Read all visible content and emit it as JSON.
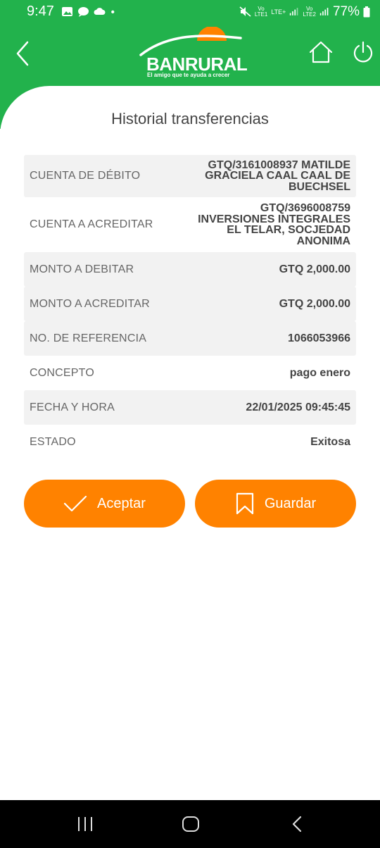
{
  "status_bar": {
    "time": "9:47",
    "sim1_line1": "Vo",
    "sim1_line2": "LTE1",
    "network_label": "LTE+",
    "sim2_line1": "Vo",
    "sim2_line2": "LTE2",
    "battery_percent": "77%",
    "icons": [
      "gallery-icon",
      "chat-icon",
      "cloud-icon",
      "dot-icon",
      "mute-icon",
      "signal-icon",
      "battery-icon"
    ]
  },
  "header": {
    "brand": "BANRURAL",
    "tagline": "El amigo que te ayuda a crecer",
    "colors": {
      "header_green": "#22b24c",
      "logo_orange": "#ff8200"
    }
  },
  "page": {
    "title": "Historial transferencias"
  },
  "details": [
    {
      "label": "CUENTA DE DÉBITO",
      "value": "GTQ/3161008937 MATILDE GRACIELA CAAL CAAL DE BUECHSEL"
    },
    {
      "label": "CUENTA A ACREDITAR",
      "value": "GTQ/3696008759 INVERSIONES INTEGRALES EL TELAR, SOCJEDAD ANONIMA"
    },
    {
      "label": "MONTO A DEBITAR",
      "value": "GTQ 2,000.00"
    },
    {
      "label": "MONTO A ACREDITAR",
      "value": "GTQ 2,000.00"
    },
    {
      "label": "NO. DE REFERENCIA",
      "value": "1066053966"
    },
    {
      "label": "CONCEPTO",
      "value": "pago enero"
    },
    {
      "label": "FECHA Y HORA",
      "value": "22/01/2025 09:45:45"
    },
    {
      "label": "ESTADO",
      "value": "Exitosa"
    }
  ],
  "actions": {
    "accept_label": "Aceptar",
    "save_label": "Guardar",
    "button_color": "#ff8200"
  }
}
